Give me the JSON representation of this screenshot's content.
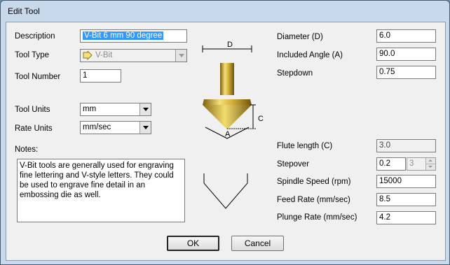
{
  "window": {
    "title": "Edit Tool"
  },
  "left": {
    "description": {
      "label": "Description",
      "value": "V-Bit 6 mm 90 degree"
    },
    "tool_type": {
      "label": "Tool Type",
      "value": "V-Bit"
    },
    "tool_number": {
      "label": "Tool Number",
      "value": "1"
    },
    "tool_units": {
      "label": "Tool Units",
      "value": "mm"
    },
    "rate_units": {
      "label": "Rate Units",
      "value": "mm/sec"
    },
    "notes": {
      "label": "Notes:",
      "value": "V-Bit tools are generally used for engraving fine lettering and V-style letters. They could be used to engrave fine detail in an embossing die as well."
    }
  },
  "diagram": {
    "d_label": "D",
    "c_label": "C",
    "a_label": "A"
  },
  "right": {
    "diameter": {
      "label": "Diameter (D)",
      "value": "6.0"
    },
    "included_angle": {
      "label": "Included Angle (A)",
      "value": "90.0"
    },
    "stepdown": {
      "label": "Stepdown",
      "value": "0.75"
    },
    "flute_length": {
      "label": "Flute length (C)",
      "value": "3.0"
    },
    "stepover": {
      "label": "Stepover",
      "value": "0.2",
      "spin_value": "3"
    },
    "spindle_speed": {
      "label": "Spindle Speed (rpm)",
      "value": "15000"
    },
    "feed_rate": {
      "label": "Feed Rate (mm/sec)",
      "value": "8.5"
    },
    "plunge_rate": {
      "label": "Plunge Rate (mm/sec)",
      "value": "4.2"
    }
  },
  "buttons": {
    "ok": "OK",
    "cancel": "Cancel"
  },
  "colors": {
    "selection": "#3399ff",
    "tool_gold": "#c9a227",
    "frame": "#c9d9ec"
  }
}
